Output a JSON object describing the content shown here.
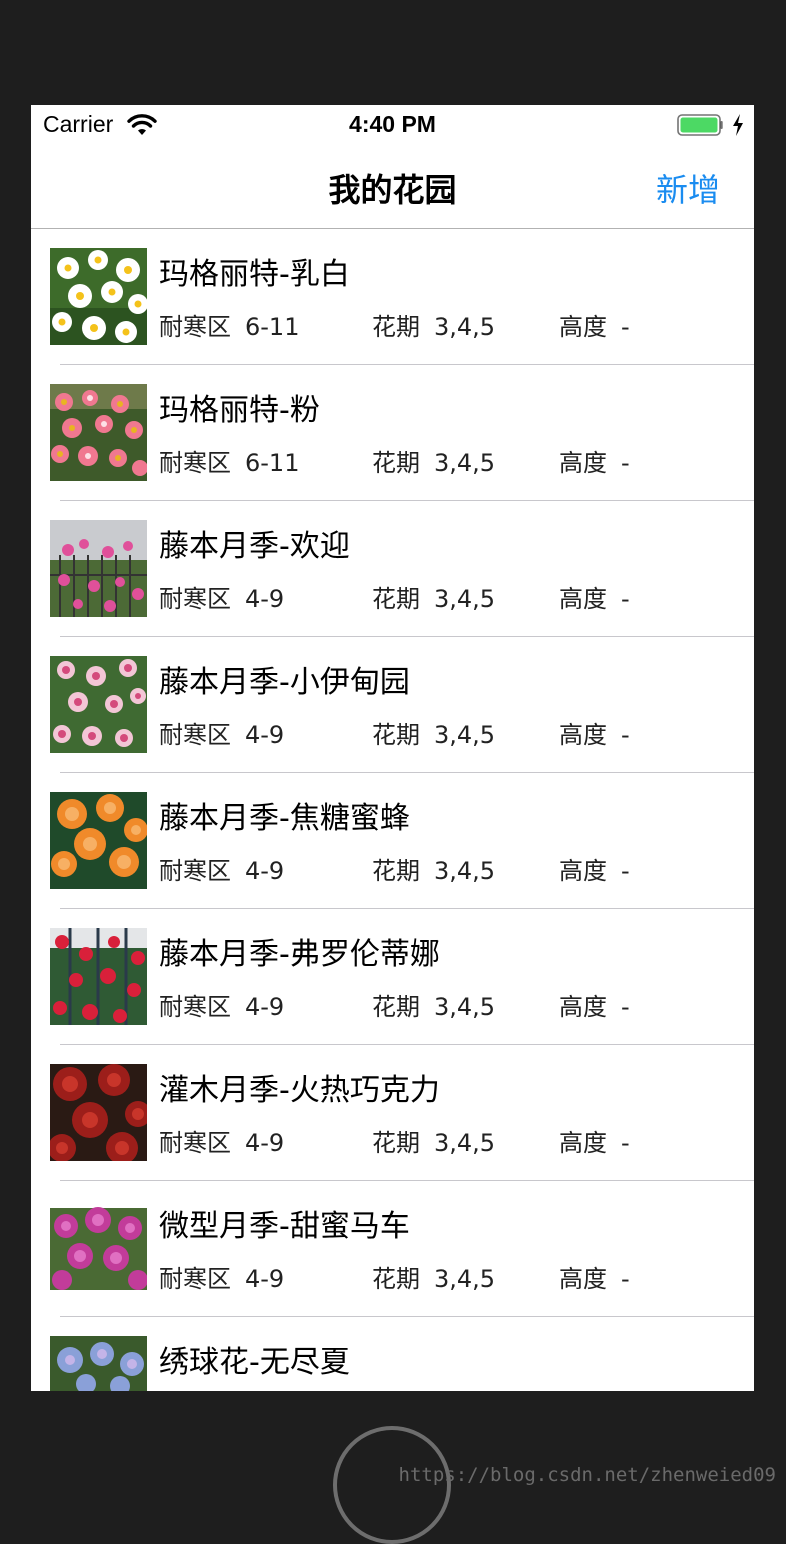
{
  "status_bar": {
    "carrier": "Carrier",
    "time": "4:40 PM",
    "wifi_icon": "wifi-icon",
    "battery_icon": "battery-icon",
    "charging_icon": "bolt-icon"
  },
  "nav": {
    "title": "我的花园",
    "add_label": "新增",
    "accent_color": "#1a8cf0"
  },
  "labels": {
    "hardiness": "耐寒区",
    "bloom": "花期",
    "height": "高度"
  },
  "plants": [
    {
      "name": "玛格丽特-乳白",
      "zone": "6-11",
      "bloom": "3,4,5",
      "height": "-",
      "thumb": "white-daisy-photo"
    },
    {
      "name": "玛格丽特-粉",
      "zone": "6-11",
      "bloom": "3,4,5",
      "height": "-",
      "thumb": "pink-daisy-photo"
    },
    {
      "name": "藤本月季-欢迎",
      "zone": "4-9",
      "bloom": "3,4,5",
      "height": "-",
      "thumb": "pink-climbing-rose-photo"
    },
    {
      "name": "藤本月季-小伊甸园",
      "zone": "4-9",
      "bloom": "3,4,5",
      "height": "-",
      "thumb": "light-pink-rose-photo"
    },
    {
      "name": "藤本月季-焦糖蜜蜂",
      "zone": "4-9",
      "bloom": "3,4,5",
      "height": "-",
      "thumb": "orange-rose-photo"
    },
    {
      "name": "藤本月季-弗罗伦蒂娜",
      "zone": "4-9",
      "bloom": "3,4,5",
      "height": "-",
      "thumb": "red-climbing-rose-photo"
    },
    {
      "name": "灌木月季-火热巧克力",
      "zone": "4-9",
      "bloom": "3,4,5",
      "height": "-",
      "thumb": "dark-red-rose-photo"
    },
    {
      "name": "微型月季-甜蜜马车",
      "zone": "4-9",
      "bloom": "3,4,5",
      "height": "-",
      "thumb": "magenta-rose-photo"
    },
    {
      "name": "绣球花-无尽夏",
      "zone": "",
      "bloom": "",
      "height": "",
      "thumb": "hydrangea-photo"
    }
  ],
  "watermark": "https://blog.csdn.net/zhenweied09"
}
